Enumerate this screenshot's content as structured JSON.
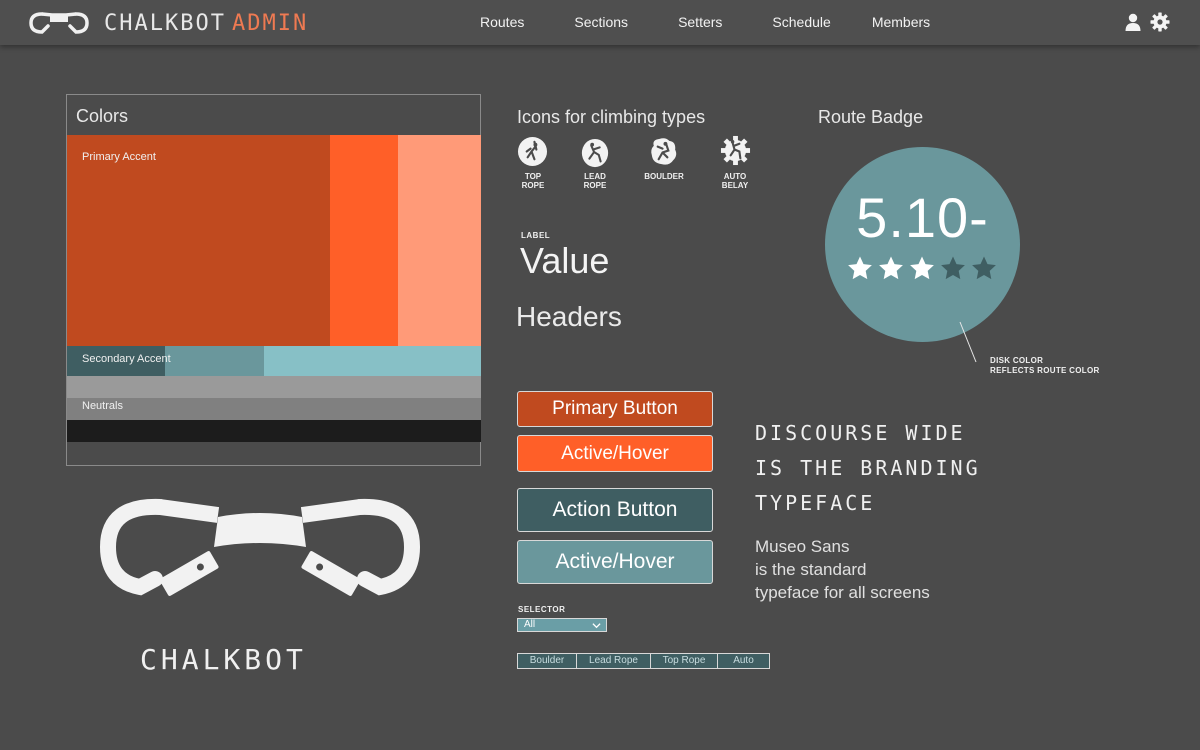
{
  "nav": {
    "brand_name": "CHALKBOT",
    "brand_suffix": "ADMIN",
    "links": [
      "Routes",
      "Sections",
      "Setters",
      "Schedule",
      "Members"
    ],
    "icons": [
      "user-icon",
      "gear-icon"
    ]
  },
  "colors_panel": {
    "title": "Colors",
    "primary_accent_label": "Primary Accent",
    "secondary_accent_label": "Secondary Accent",
    "neutrals_label": "Neutrals",
    "swatches": {
      "primary": [
        "#c04a1f",
        "#ff5f28",
        "#ff9a78"
      ],
      "secondary": [
        "#3f5e62",
        "#6a979c",
        "#87c0c6"
      ],
      "neutrals": [
        "#9a9a9a",
        "#808080",
        "#1c1c1c"
      ]
    }
  },
  "logo": {
    "wordmark": "CHALKBOT"
  },
  "icons_section": {
    "title": "Icons for climbing types",
    "items": [
      {
        "icon": "top-rope-icon",
        "line1": "TOP",
        "line2": "ROPE"
      },
      {
        "icon": "lead-rope-icon",
        "line1": "LEAD",
        "line2": "ROPE"
      },
      {
        "icon": "boulder-icon",
        "line1": "BOULDER",
        "line2": ""
      },
      {
        "icon": "auto-belay-icon",
        "line1": "AUTO",
        "line2": "BELAY"
      }
    ]
  },
  "type_samples": {
    "label": "LABEL",
    "value": "Value",
    "headers": "Headers"
  },
  "buttons": {
    "primary": "Primary Button",
    "primary_hover": "Active/Hover",
    "action": "Action Button",
    "action_hover": "Active/Hover"
  },
  "selector": {
    "label": "SELECTOR",
    "value": "All"
  },
  "segmented": {
    "options": [
      "Boulder",
      "Lead Rope",
      "Top Rope",
      "Auto"
    ]
  },
  "typography": {
    "branding_lines": [
      "DISCOURSE WIDE",
      "IS THE BRANDING",
      "TYPEFACE"
    ],
    "standard_lines": [
      "Museo Sans",
      "is the standard",
      "typeface for all screens"
    ]
  },
  "route_badge": {
    "title": "Route Badge",
    "grade": "5.10-",
    "stars_filled": 3,
    "stars_total": 5,
    "disk_color": "#6a979c",
    "note_line1": "DISK COLOR",
    "note_line2": "REFLECTS ROUTE COLOR"
  }
}
